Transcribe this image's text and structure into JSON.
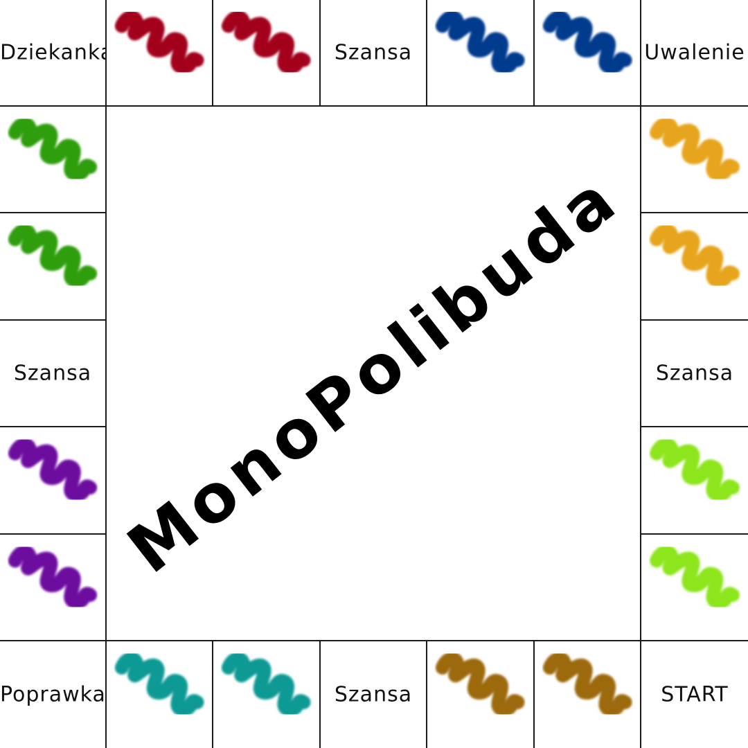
{
  "board": {
    "title": "MonoPolibuda",
    "corners": {
      "top_left": "Dziekanka",
      "top_right": "Uwalenie",
      "bottom_left": "Poprawka",
      "bottom_right": "START"
    },
    "chance_labels": {
      "top": "Szansa",
      "left": "Szansa",
      "right": "Szansa",
      "bottom": "Szansa"
    },
    "property_colors": {
      "top_red": "#a3001e",
      "top_blue": "#003b8e",
      "left_green": "#2e9e07",
      "left_purple": "#6d0aa0",
      "right_orange": "#e6a51f",
      "right_lime": "#8de51f",
      "bottom_teal": "#0f9a94",
      "bottom_brown": "#9c6a08"
    },
    "property_icon": "colored-scribble"
  }
}
